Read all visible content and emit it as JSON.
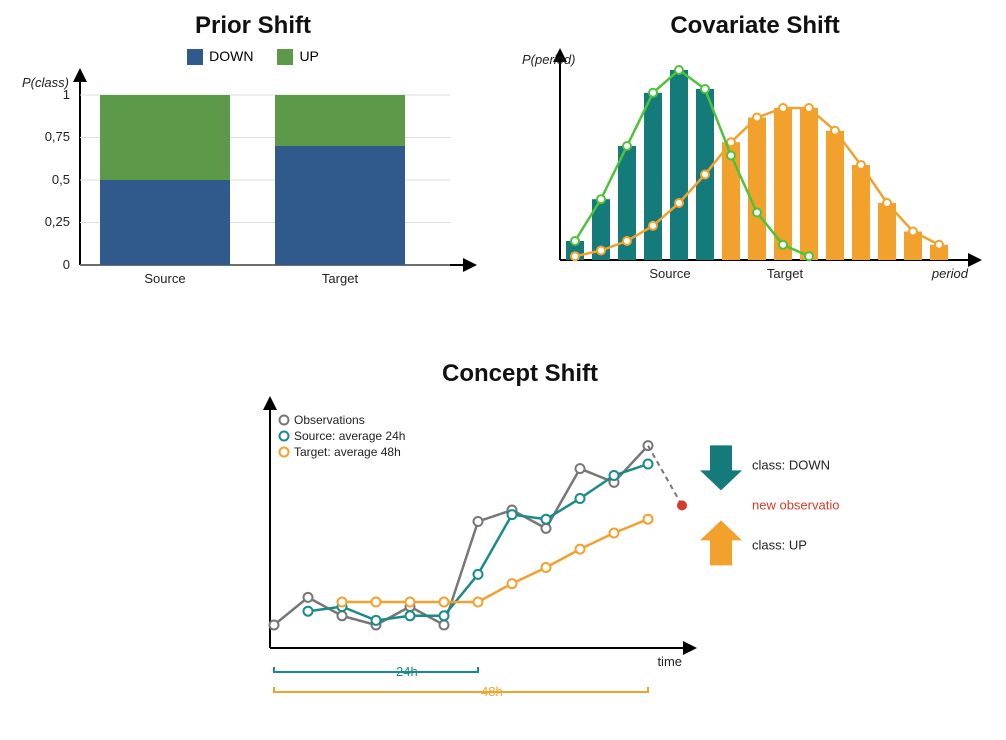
{
  "panels": {
    "prior": {
      "title": "Prior Shift",
      "ylabel": "P(class)",
      "legend": {
        "down": "DOWN",
        "up": "UP"
      },
      "ticks": [
        "0",
        "0,25",
        "0,5",
        "0,75",
        "1"
      ],
      "categories": {
        "source": "Source",
        "target": "Target"
      }
    },
    "covariate": {
      "title": "Covariate Shift",
      "ylabel": "P(period)",
      "xlabel": "period",
      "categories": {
        "source": "Source",
        "target": "Target"
      }
    },
    "concept": {
      "title": "Concept Shift",
      "legend": {
        "obs": "Observations",
        "src": "Source: average 24h",
        "tgt": "Target: average 48h"
      },
      "xlabel": "time",
      "span24": "24h",
      "span48": "48h",
      "classDown": "class: DOWN",
      "newObs": "new observation",
      "classUp": "class: UP"
    }
  },
  "colors": {
    "down": "#2f5a8b",
    "up": "#5c9a4a",
    "teal": "#1a8a8a",
    "tealDark": "#157a7a",
    "orange": "#f2a12d",
    "gray": "#777",
    "red": "#d63b2a",
    "green": "#4fc23a"
  },
  "chart_data": [
    {
      "id": "prior",
      "type": "bar",
      "title": "Prior Shift",
      "ylabel": "P(class)",
      "ylim": [
        0,
        1
      ],
      "categories": [
        "Source",
        "Target"
      ],
      "stacked": true,
      "series": [
        {
          "name": "DOWN",
          "values": [
            0.5,
            0.7
          ],
          "color": "#2f5a8b"
        },
        {
          "name": "UP",
          "values": [
            0.5,
            0.3
          ],
          "color": "#5c9a4a"
        }
      ]
    },
    {
      "id": "covariate",
      "type": "bar+line",
      "title": "Covariate Shift",
      "ylabel": "P(period)",
      "xlabel": "period",
      "ylim": [
        0,
        1
      ],
      "x": [
        1,
        2,
        3,
        4,
        5,
        6,
        7,
        8,
        9,
        10,
        11,
        12,
        13,
        14,
        15
      ],
      "series": [
        {
          "name": "Source",
          "kind": "histogram",
          "color": "#157a7a",
          "values": [
            0.1,
            0.32,
            0.6,
            0.88,
            1.0,
            0.9,
            0,
            0,
            0,
            0,
            0,
            0,
            0,
            0,
            0
          ]
        },
        {
          "name": "Source-curve",
          "kind": "line",
          "color": "#4fc23a",
          "values": [
            0.1,
            0.32,
            0.6,
            0.88,
            1.0,
            0.9,
            0.55,
            0.25,
            0.08,
            0.02,
            0,
            0,
            0,
            0,
            0
          ]
        },
        {
          "name": "Target",
          "kind": "histogram",
          "color": "#f2a12d",
          "values": [
            0.02,
            0.05,
            0.1,
            0.18,
            0.3,
            0.45,
            0.62,
            0.75,
            0.8,
            0.8,
            0.68,
            0.5,
            0.3,
            0.15,
            0.08
          ]
        },
        {
          "name": "Target-curve",
          "kind": "line",
          "color": "#f2a12d",
          "values": [
            0.02,
            0.05,
            0.1,
            0.18,
            0.3,
            0.45,
            0.62,
            0.75,
            0.8,
            0.8,
            0.68,
            0.5,
            0.3,
            0.15,
            0.08
          ]
        }
      ],
      "category_positions": {
        "Source": 5,
        "Target": 9
      }
    },
    {
      "id": "concept",
      "type": "line",
      "title": "Concept Shift",
      "xlabel": "time",
      "x": [
        0,
        1,
        2,
        3,
        4,
        5,
        6,
        7,
        8,
        9,
        10,
        11
      ],
      "series": [
        {
          "name": "Observations",
          "color": "#777",
          "values": [
            10,
            22,
            14,
            10,
            18,
            10,
            55,
            60,
            52,
            78,
            72,
            88
          ]
        },
        {
          "name": "Source: average 24h",
          "color": "#1a8a8a",
          "values": [
            null,
            16,
            18,
            12,
            14,
            14,
            32,
            58,
            56,
            65,
            75,
            80
          ]
        },
        {
          "name": "Target: average 48h",
          "color": "#f2a12d",
          "values": [
            null,
            null,
            20,
            20,
            20,
            20,
            20,
            28,
            35,
            43,
            50,
            56
          ]
        }
      ],
      "annotations": {
        "new_observation_x": 12,
        "new_observation_y": 62,
        "ref_down_y": 80,
        "ref_up_y": 56,
        "span_24h": [
          0,
          6
        ],
        "span_48h": [
          0,
          11
        ]
      }
    }
  ]
}
